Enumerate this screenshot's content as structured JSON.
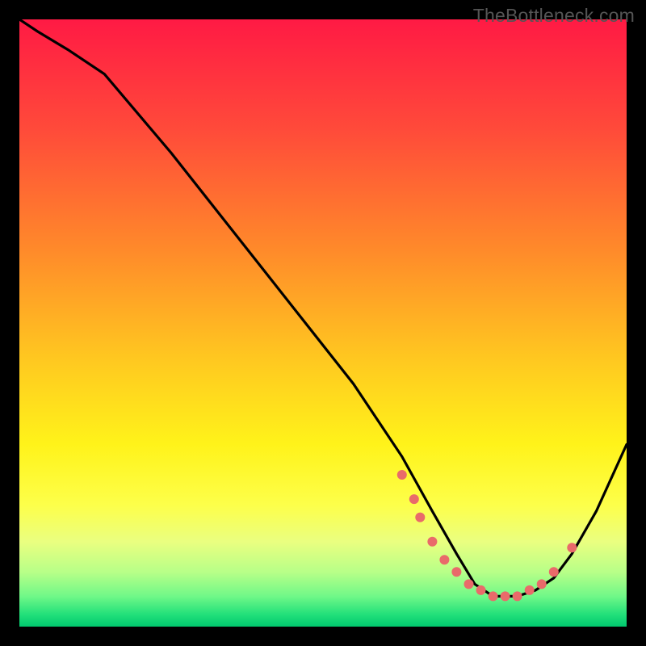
{
  "watermark": "TheBottleneck.com",
  "chart_data": {
    "type": "line",
    "title": "",
    "xlabel": "",
    "ylabel": "",
    "xlim": [
      0,
      100
    ],
    "ylim": [
      0,
      100
    ],
    "grid": false,
    "legend": false,
    "curve_remark": "black curve descends from top-left, flattens into a valley around x≈78, rises on the right; coral marker dots cluster in the valley",
    "series": [
      {
        "name": "curve",
        "color": "#000000",
        "x": [
          0,
          3,
          8,
          14,
          25,
          40,
          55,
          63,
          68,
          72,
          75,
          78,
          82,
          85,
          88,
          91,
          95,
          100
        ],
        "y": [
          100,
          98,
          95,
          91,
          78,
          59,
          40,
          28,
          19,
          12,
          7,
          5,
          5,
          6,
          8,
          12,
          19,
          30
        ]
      },
      {
        "name": "markers",
        "color": "#e96a6a",
        "type_hint": "scatter",
        "x": [
          63,
          65,
          66,
          68,
          70,
          72,
          74,
          76,
          78,
          80,
          82,
          84,
          86,
          88,
          91
        ],
        "y": [
          25,
          21,
          18,
          14,
          11,
          9,
          7,
          6,
          5,
          5,
          5,
          6,
          7,
          9,
          13
        ]
      }
    ]
  }
}
